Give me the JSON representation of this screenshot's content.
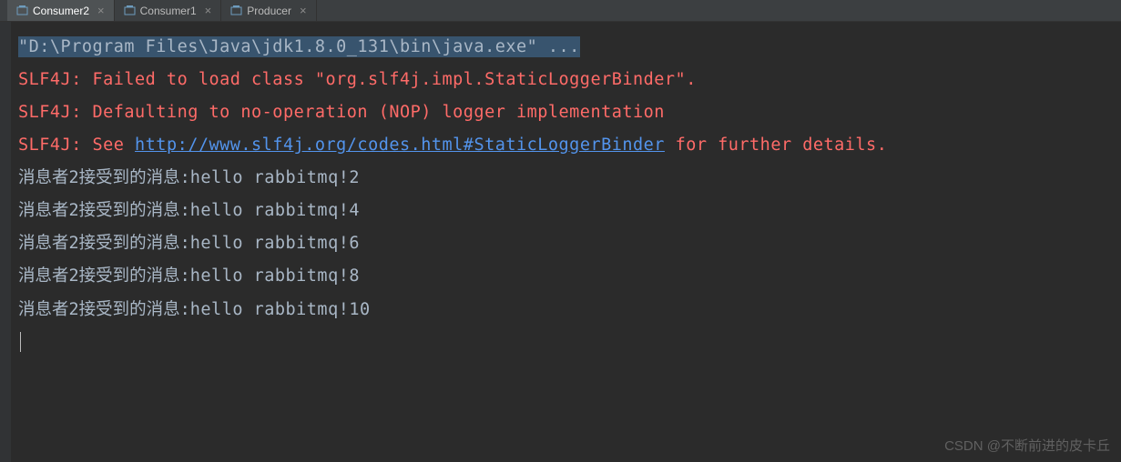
{
  "tabs": [
    {
      "label": "Consumer2",
      "active": true
    },
    {
      "label": "Consumer1",
      "active": false
    },
    {
      "label": "Producer",
      "active": false
    }
  ],
  "console": {
    "command": "\"D:\\Program Files\\Java\\jdk1.8.0_131\\bin\\java.exe\" ...",
    "error1": "SLF4J: Failed to load class \"org.slf4j.impl.StaticLoggerBinder\".",
    "error2": "SLF4J: Defaulting to no-operation (NOP) logger implementation",
    "error3_pre": "SLF4J: See ",
    "error3_link": "http://www.slf4j.org/codes.html#StaticLoggerBinder",
    "error3_post": " for further details.",
    "output": [
      {
        "prefix": "消息者2接受到的消息:",
        "msg": "hello rabbitmq!2"
      },
      {
        "prefix": "消息者2接受到的消息:",
        "msg": "hello rabbitmq!4"
      },
      {
        "prefix": "消息者2接受到的消息:",
        "msg": "hello rabbitmq!6"
      },
      {
        "prefix": "消息者2接受到的消息:",
        "msg": "hello rabbitmq!8"
      },
      {
        "prefix": "消息者2接受到的消息:",
        "msg": "hello rabbitmq!10"
      }
    ]
  },
  "watermark": "CSDN @不断前进的皮卡丘"
}
